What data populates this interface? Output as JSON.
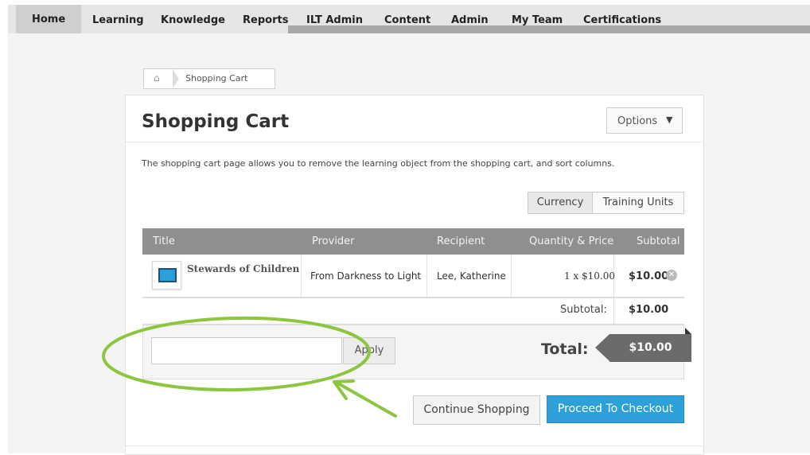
{
  "nav": {
    "items": [
      "Home",
      "Learning",
      "Knowledge",
      "Reports",
      "ILT Admin",
      "Content",
      "Admin",
      "My Team",
      "Certifications"
    ]
  },
  "breadcrumb": {
    "home_icon": "home-icon",
    "current": "Shopping Cart"
  },
  "page": {
    "title": "Shopping Cart",
    "options_label": "Options",
    "description": "The shopping cart page allows you to remove the learning object from the shopping cart, and sort columns."
  },
  "toggle": {
    "currency": "Currency",
    "training_units": "Training Units"
  },
  "table": {
    "headers": [
      "Title",
      "Provider",
      "Recipient",
      "Quantity & Price",
      "Subtotal"
    ],
    "rows": [
      {
        "title": "Stewards of Children",
        "provider": "From Darkness to Light",
        "recipient": "Lee, Katherine",
        "quantity_price": "1 x $10.00",
        "subtotal": "$10.00",
        "thumbnail_icon": "monitor-icon"
      }
    ],
    "subtotal_label": "Subtotal:",
    "subtotal_value": "$10.00"
  },
  "coupon": {
    "value": "",
    "apply_label": "Apply"
  },
  "total": {
    "label": "Total:",
    "value": "$10.00"
  },
  "actions": {
    "continue": "Continue Shopping",
    "checkout": "Proceed To Checkout"
  },
  "colors": {
    "accent": "#2d9fd9",
    "annotation": "#8cc63f",
    "header_bg": "#8f8f8f"
  }
}
